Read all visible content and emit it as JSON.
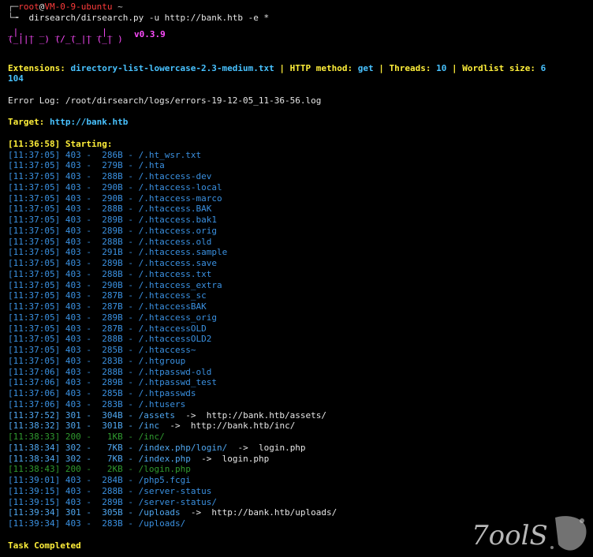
{
  "prompt": {
    "user": "root",
    "at": "@",
    "host": "VM-0-9-ubuntu",
    "path": "~",
    "arrow": "└╼",
    "command": "dirsearch/dirsearch.py -u http://bank.htb -e *"
  },
  "banner": {
    "art_line1": "_|. _ _  _  _  _ _|_",
    "art_line2": "(_||| _) (/_(_|| (_| )",
    "version": "v0.3.9"
  },
  "config": {
    "extensions_label": "Extensions:",
    "extensions_value": "directory-list-lowercase-2.3-medium.txt",
    "sep1": "|",
    "method_label": "HTTP method:",
    "method_value": "get",
    "sep2": "|",
    "threads_label": "Threads:",
    "threads_value": "10",
    "sep3": "|",
    "wordlist_label": "Wordlist size:",
    "wordlist_value_line1": "6",
    "wordlist_value_line2": "104"
  },
  "error_log": "Error Log: /root/dirsearch/logs/errors-19-12-05_11-36-56.log",
  "target": {
    "label": "Target:",
    "url": "http://bank.htb"
  },
  "starting": "[11:36:58] Starting:",
  "results": [
    {
      "t": "[11:37:05]",
      "code": "403",
      "size": "286B",
      "path": "/.ht_wsr.txt",
      "redirect": "",
      "color": "blue"
    },
    {
      "t": "[11:37:05]",
      "code": "403",
      "size": "279B",
      "path": "/.hta",
      "redirect": "",
      "color": "blue"
    },
    {
      "t": "[11:37:05]",
      "code": "403",
      "size": "288B",
      "path": "/.htaccess-dev",
      "redirect": "",
      "color": "blue"
    },
    {
      "t": "[11:37:05]",
      "code": "403",
      "size": "290B",
      "path": "/.htaccess-local",
      "redirect": "",
      "color": "blue"
    },
    {
      "t": "[11:37:05]",
      "code": "403",
      "size": "290B",
      "path": "/.htaccess-marco",
      "redirect": "",
      "color": "blue"
    },
    {
      "t": "[11:37:05]",
      "code": "403",
      "size": "288B",
      "path": "/.htaccess.BAK",
      "redirect": "",
      "color": "blue"
    },
    {
      "t": "[11:37:05]",
      "code": "403",
      "size": "289B",
      "path": "/.htaccess.bak1",
      "redirect": "",
      "color": "blue"
    },
    {
      "t": "[11:37:05]",
      "code": "403",
      "size": "289B",
      "path": "/.htaccess.orig",
      "redirect": "",
      "color": "blue"
    },
    {
      "t": "[11:37:05]",
      "code": "403",
      "size": "288B",
      "path": "/.htaccess.old",
      "redirect": "",
      "color": "blue"
    },
    {
      "t": "[11:37:05]",
      "code": "403",
      "size": "291B",
      "path": "/.htaccess.sample",
      "redirect": "",
      "color": "blue"
    },
    {
      "t": "[11:37:05]",
      "code": "403",
      "size": "289B",
      "path": "/.htaccess.save",
      "redirect": "",
      "color": "blue"
    },
    {
      "t": "[11:37:05]",
      "code": "403",
      "size": "288B",
      "path": "/.htaccess.txt",
      "redirect": "",
      "color": "blue"
    },
    {
      "t": "[11:37:05]",
      "code": "403",
      "size": "290B",
      "path": "/.htaccess_extra",
      "redirect": "",
      "color": "blue"
    },
    {
      "t": "[11:37:05]",
      "code": "403",
      "size": "287B",
      "path": "/.htaccess_sc",
      "redirect": "",
      "color": "blue"
    },
    {
      "t": "[11:37:05]",
      "code": "403",
      "size": "287B",
      "path": "/.htaccessBAK",
      "redirect": "",
      "color": "blue"
    },
    {
      "t": "[11:37:05]",
      "code": "403",
      "size": "289B",
      "path": "/.htaccess_orig",
      "redirect": "",
      "color": "blue"
    },
    {
      "t": "[11:37:05]",
      "code": "403",
      "size": "287B",
      "path": "/.htaccessOLD",
      "redirect": "",
      "color": "blue"
    },
    {
      "t": "[11:37:05]",
      "code": "403",
      "size": "288B",
      "path": "/.htaccessOLD2",
      "redirect": "",
      "color": "blue"
    },
    {
      "t": "[11:37:05]",
      "code": "403",
      "size": "285B",
      "path": "/.htaccess~",
      "redirect": "",
      "color": "blue"
    },
    {
      "t": "[11:37:05]",
      "code": "403",
      "size": "283B",
      "path": "/.htgroup",
      "redirect": "",
      "color": "blue"
    },
    {
      "t": "[11:37:06]",
      "code": "403",
      "size": "288B",
      "path": "/.htpasswd-old",
      "redirect": "",
      "color": "blue"
    },
    {
      "t": "[11:37:06]",
      "code": "403",
      "size": "289B",
      "path": "/.htpasswd_test",
      "redirect": "",
      "color": "blue"
    },
    {
      "t": "[11:37:06]",
      "code": "403",
      "size": "285B",
      "path": "/.htpasswds",
      "redirect": "",
      "color": "blue"
    },
    {
      "t": "[11:37:06]",
      "code": "403",
      "size": "283B",
      "path": "/.htusers",
      "redirect": "",
      "color": "blue"
    },
    {
      "t": "[11:37:52]",
      "code": "301",
      "size": "304B",
      "path": "/assets",
      "redirect": "http://bank.htb/assets/",
      "color": "cyanish"
    },
    {
      "t": "[11:38:32]",
      "code": "301",
      "size": "301B",
      "path": "/inc",
      "redirect": "http://bank.htb/inc/",
      "color": "cyanish"
    },
    {
      "t": "[11:38:33]",
      "code": "200",
      "size": "1KB",
      "path": "/inc/",
      "redirect": "",
      "color": "green"
    },
    {
      "t": "[11:38:34]",
      "code": "302",
      "size": "7KB",
      "path": "/index.php/login/",
      "redirect": "login.php",
      "color": "cyanish"
    },
    {
      "t": "[11:38:34]",
      "code": "302",
      "size": "7KB",
      "path": "/index.php",
      "redirect": "login.php",
      "color": "cyanish"
    },
    {
      "t": "[11:38:43]",
      "code": "200",
      "size": "2KB",
      "path": "/login.php",
      "redirect": "",
      "color": "green"
    },
    {
      "t": "[11:39:01]",
      "code": "403",
      "size": "284B",
      "path": "/php5.fcgi",
      "redirect": "",
      "color": "blue"
    },
    {
      "t": "[11:39:15]",
      "code": "403",
      "size": "288B",
      "path": "/server-status",
      "redirect": "",
      "color": "blue"
    },
    {
      "t": "[11:39:15]",
      "code": "403",
      "size": "289B",
      "path": "/server-status/",
      "redirect": "",
      "color": "blue"
    },
    {
      "t": "[11:39:34]",
      "code": "301",
      "size": "305B",
      "path": "/uploads",
      "redirect": "http://bank.htb/uploads/",
      "color": "cyanish"
    },
    {
      "t": "[11:39:34]",
      "code": "403",
      "size": "283B",
      "path": "/uploads/",
      "redirect": "",
      "color": "blue"
    }
  ],
  "task_completed": "Task Completed",
  "watermark": "7oolS",
  "colors": {
    "background": "#000000",
    "error_403": "#3a90e0",
    "redirect": "#4fa6ef",
    "ok_200": "#2f9a2f",
    "label_yellow": "#ffef3a",
    "value_cyan": "#48c2ff",
    "banner_magenta": "#ff4cff",
    "prompt_red": "#ff3b3b"
  }
}
